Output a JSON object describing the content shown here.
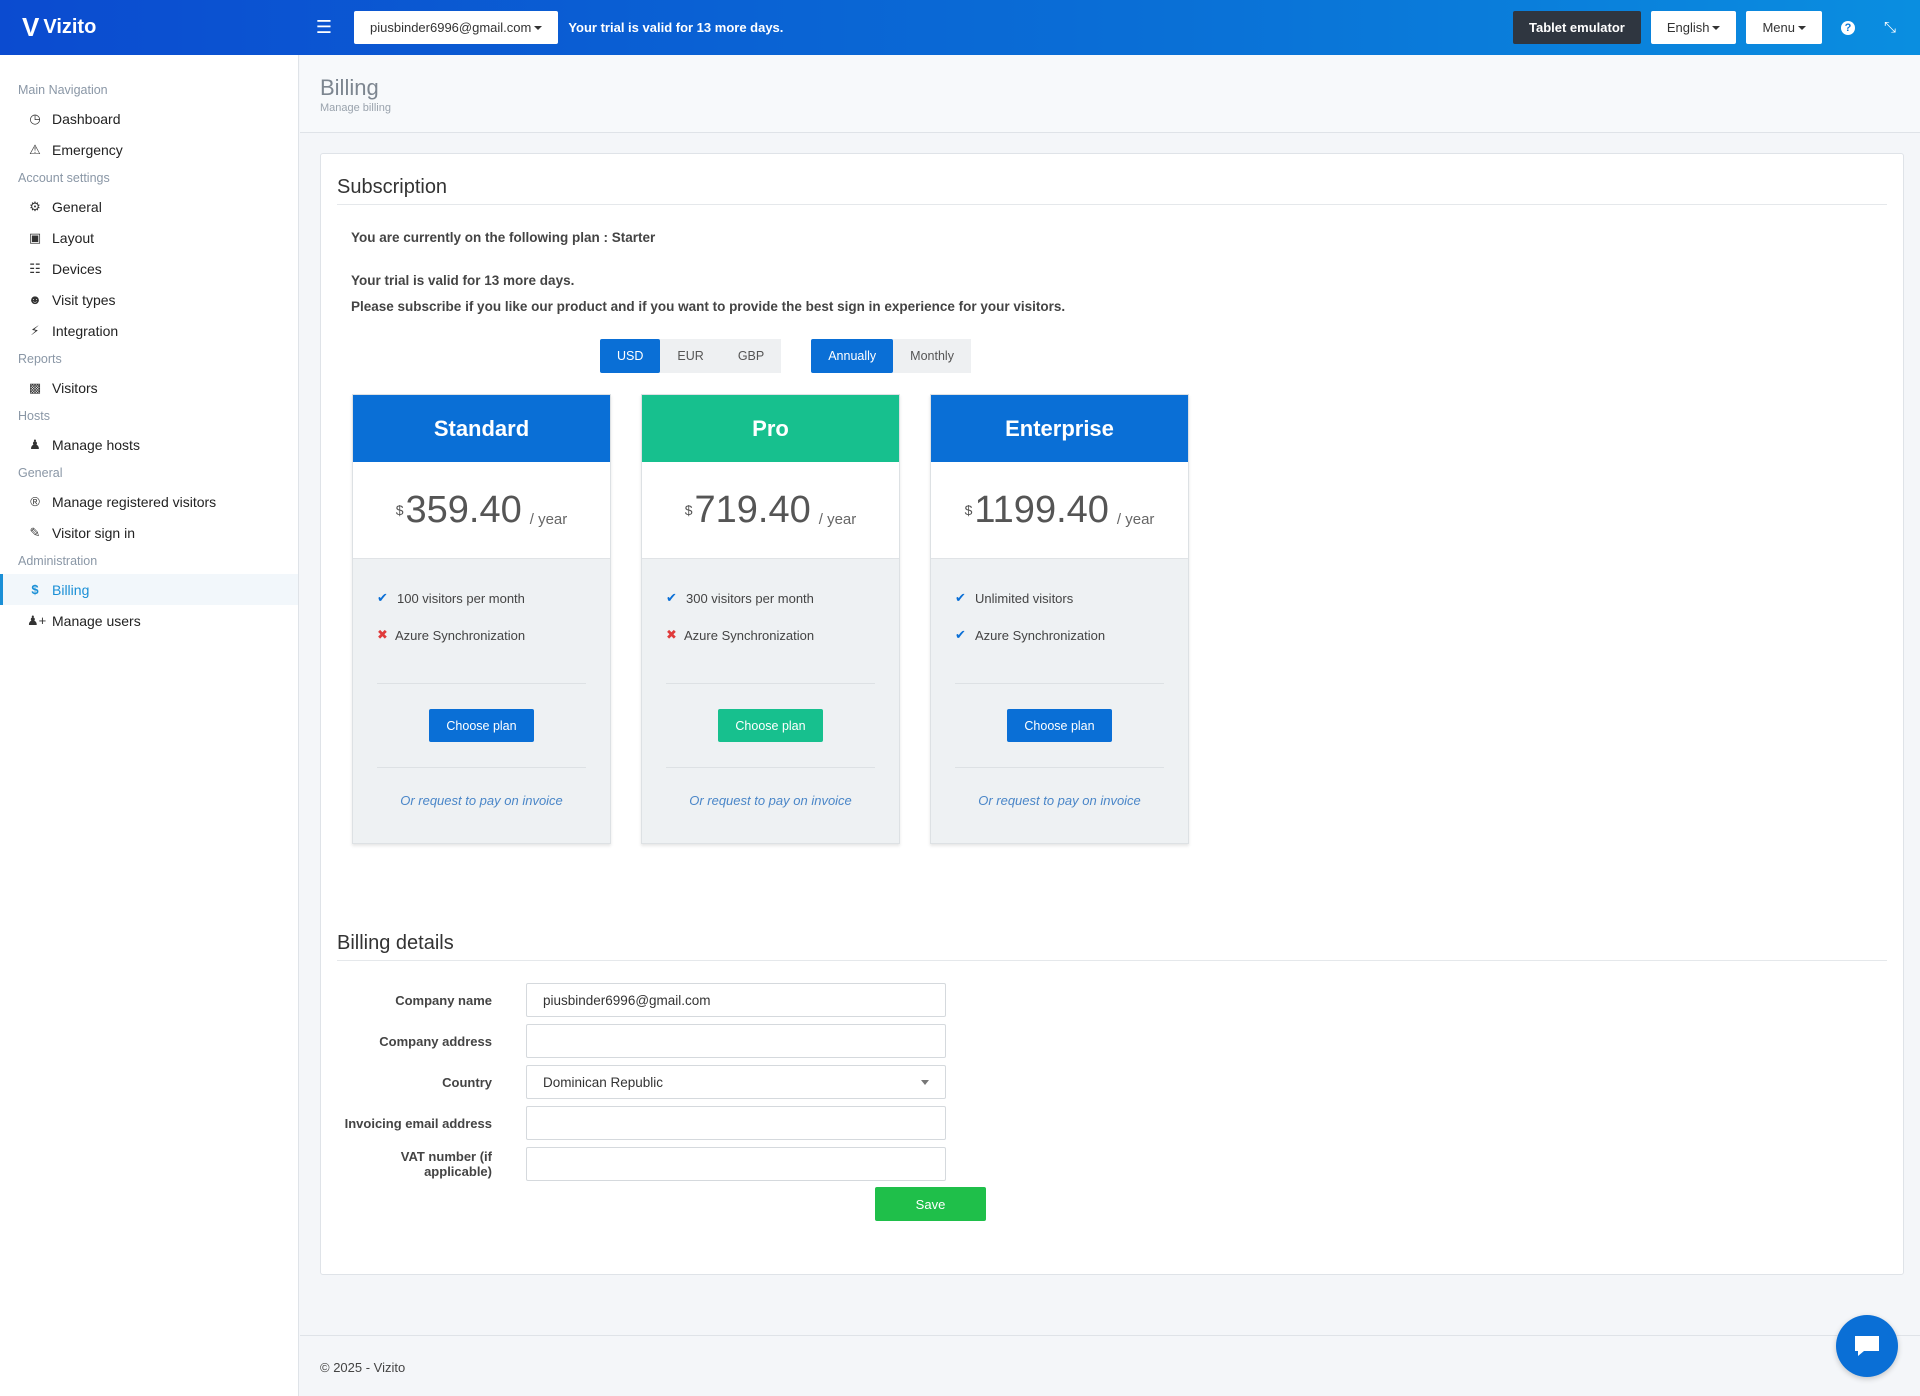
{
  "app": {
    "name": "Vizito",
    "account_email": "piusbinder6996@gmail.com",
    "trial_banner": "Your trial is valid for 13 more days.",
    "tablet_emulator": "Tablet emulator",
    "language": "English",
    "menu": "Menu",
    "accent_color": "#0a6fd6"
  },
  "sidebar": {
    "sections": {
      "main_navigation": "Main Navigation",
      "account_settings": "Account settings",
      "reports": "Reports",
      "hosts": "Hosts",
      "general": "General",
      "administration": "Administration"
    },
    "items": {
      "dashboard": {
        "label": "Dashboard",
        "icon": "dashboard-icon"
      },
      "emergency": {
        "label": "Emergency",
        "icon": "warning-icon"
      },
      "general": {
        "label": "General",
        "icon": "gear-icon"
      },
      "layout": {
        "label": "Layout",
        "icon": "image-icon"
      },
      "devices": {
        "label": "Devices",
        "icon": "sitemap-icon"
      },
      "visit_types": {
        "label": "Visit types",
        "icon": "users-icon"
      },
      "integration": {
        "label": "Integration",
        "icon": "plug-icon"
      },
      "visitors": {
        "label": "Visitors",
        "icon": "book-icon"
      },
      "manage_hosts": {
        "label": "Manage hosts",
        "icon": "person-icon"
      },
      "manage_registered_visitors": {
        "label": "Manage registered visitors",
        "icon": "registered-icon"
      },
      "visitor_sign_in": {
        "label": "Visitor sign in",
        "icon": "pencil-icon"
      },
      "billing": {
        "label": "Billing",
        "icon": "dollar-icon"
      },
      "manage_users": {
        "label": "Manage users",
        "icon": "user-plus-icon"
      }
    }
  },
  "header": {
    "title": "Billing",
    "subtitle": "Manage billing"
  },
  "subscription": {
    "title": "Subscription",
    "current_plan": "You are currently on the following plan : Starter",
    "trial_line": "Your trial is valid for 13 more days.",
    "subscribe_line": "Please subscribe if you like our product and if you want to provide the best sign in experience for your visitors.",
    "currencies": [
      "USD",
      "EUR",
      "GBP"
    ],
    "selected_currency": "USD",
    "periods": [
      "Annually",
      "Monthly"
    ],
    "selected_period": "Annually",
    "plans": [
      {
        "name": "Standard",
        "currency_symbol": "$",
        "price": "359.40",
        "per": "/ year",
        "color": "#0a6fd6",
        "features": [
          {
            "text": "100 visitors per month",
            "included": true
          },
          {
            "text": "Azure Synchronization",
            "included": false
          }
        ],
        "button": "Choose plan",
        "invoice": "Or request to pay on invoice"
      },
      {
        "name": "Pro",
        "currency_symbol": "$",
        "price": "719.40",
        "per": "/ year",
        "color": "#17c08e",
        "features": [
          {
            "text": "300 visitors per month",
            "included": true
          },
          {
            "text": "Azure Synchronization",
            "included": false
          }
        ],
        "button": "Choose plan",
        "invoice": "Or request to pay on invoice"
      },
      {
        "name": "Enterprise",
        "currency_symbol": "$",
        "price": "1199.40",
        "per": "/ year",
        "color": "#0a6fd6",
        "features": [
          {
            "text": "Unlimited visitors",
            "included": true
          },
          {
            "text": "Azure Synchronization",
            "included": true
          }
        ],
        "button": "Choose plan",
        "invoice": "Or request to pay on invoice"
      }
    ]
  },
  "billing_details": {
    "title": "Billing details",
    "fields": {
      "company_name": {
        "label": "Company name",
        "value": "piusbinder6996@gmail.com"
      },
      "company_address": {
        "label": "Company address",
        "value": ""
      },
      "country": {
        "label": "Country",
        "value": "Dominican Republic"
      },
      "invoicing_email": {
        "label": "Invoicing email address",
        "value": ""
      },
      "vat_number": {
        "label": "VAT number (if applicable)",
        "value": ""
      }
    },
    "save": "Save"
  },
  "footer": {
    "text": "© 2025 - Vizito"
  }
}
